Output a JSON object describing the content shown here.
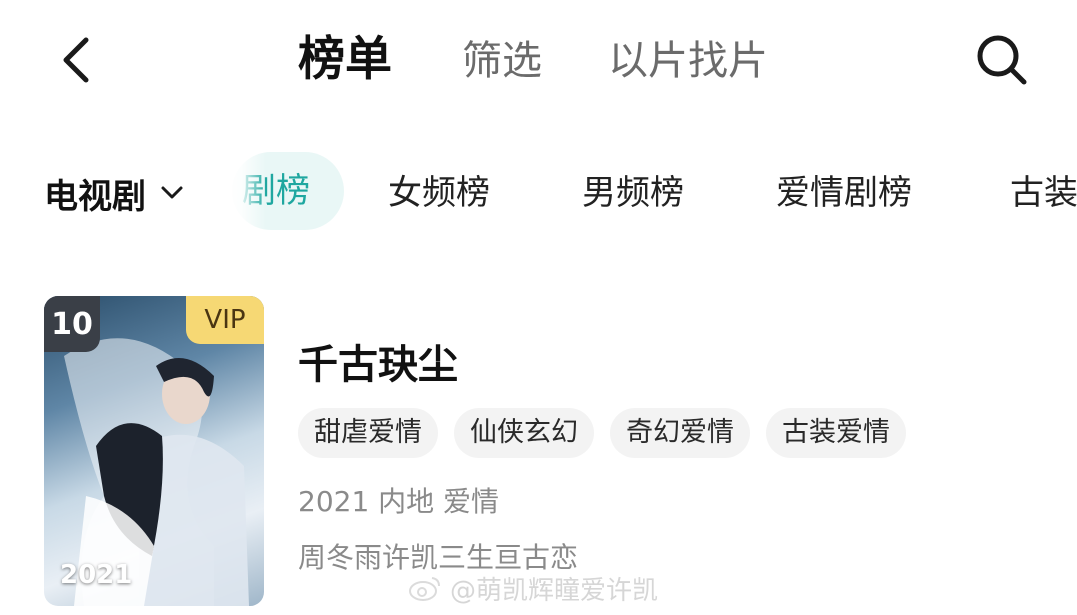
{
  "header": {
    "tabs": [
      {
        "label": "榜单",
        "active": true
      },
      {
        "label": "筛选",
        "active": false
      },
      {
        "label": "以片找片",
        "active": false
      }
    ],
    "back_icon": "chevron-left-icon",
    "search_icon": "search-icon"
  },
  "category_bar": {
    "selected_category": "电视剧",
    "dropdown_icon": "chevron-down-icon",
    "tabs": [
      {
        "label": "剧榜",
        "active": true
      },
      {
        "label": "女频榜",
        "active": false
      },
      {
        "label": "男频榜",
        "active": false
      },
      {
        "label": "爱情剧榜",
        "active": false
      },
      {
        "label": "古装",
        "active": false
      }
    ],
    "accent_color": "#1fa7a0"
  },
  "drama": {
    "rank": "10",
    "vip_label": "VIP",
    "poster_year": "2021",
    "title": "千古玦尘",
    "tags": [
      "甜虐爱情",
      "仙侠玄幻",
      "奇幻爱情",
      "古装爱情"
    ],
    "meta": "2021 内地 爱情",
    "cast": "周冬雨许凯三生亘古恋"
  },
  "watermark": {
    "text": "@萌凯辉瞳爱许凯"
  }
}
